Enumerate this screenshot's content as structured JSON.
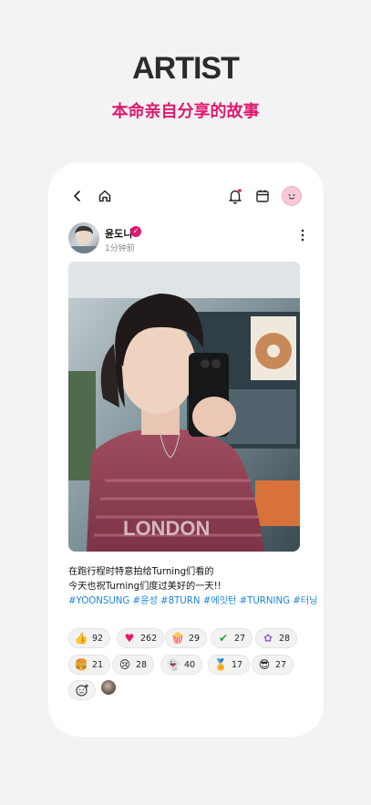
{
  "header": {
    "title": "ARTIST",
    "subtitle": "本命亲自分享的故事"
  },
  "post": {
    "author": "윤도니",
    "time": "1分钟前",
    "caption_line1": "在跑行程时特意拍给Turning们看的",
    "caption_line2": "今天也祝Turning们度过美好的一天!!",
    "hashtags": "#YOONSUNG #윤성 #8TURN #에잇턴 #TURNING #터닝"
  },
  "reactions": [
    {
      "icon": "thumbs-up-icon",
      "count": "92"
    },
    {
      "icon": "heart-icon",
      "count": "262"
    },
    {
      "icon": "popcorn-icon",
      "count": "29"
    },
    {
      "icon": "check-icon",
      "count": "27"
    },
    {
      "icon": "flower-icon",
      "count": "28"
    },
    {
      "icon": "hamburger-icon",
      "count": "21"
    },
    {
      "icon": "crying-face-icon",
      "count": "28"
    },
    {
      "icon": "ghost-face-icon",
      "count": "40"
    },
    {
      "icon": "medal-icon",
      "count": "17"
    },
    {
      "icon": "sunglasses-face-icon",
      "count": "27"
    }
  ],
  "colors": {
    "accent": "#e0186e",
    "hashtag": "#1a84e5",
    "background": "#f3f3f3"
  }
}
